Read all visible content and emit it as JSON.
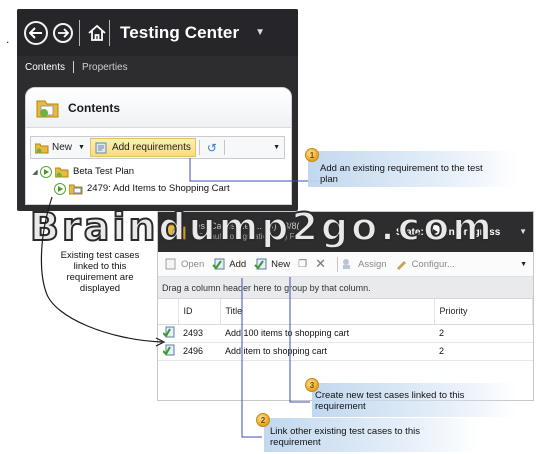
{
  "top_window": {
    "title": "Testing Center",
    "tabs": [
      "Contents",
      "Properties"
    ],
    "panel_title": "Contents",
    "toolbar": {
      "new_label": "New",
      "add_requirements_label": "Add requirements"
    },
    "tree": {
      "plan": "Beta Test Plan",
      "requirement": "2479: Add Items to Shopping Cart"
    }
  },
  "bottom_window": {
    "header_text": "Test Cases Req... (B) 23/8(...)",
    "header_sub": "Default configurations (1)  Reg...",
    "state_label": "State:",
    "state_value": "In progress",
    "toolbar": {
      "open": "Open",
      "add": "Add",
      "new": "New",
      "assign": "Assign",
      "configure": "Configur..."
    },
    "group_hint": "Drag a column header here to group by that column.",
    "columns": [
      "ID",
      "Title",
      "Priority"
    ],
    "rows": [
      {
        "id": "2493",
        "title": "Add 100 items to shopping cart",
        "priority": "2"
      },
      {
        "id": "2496",
        "title": "Add item to shopping cart",
        "priority": "2"
      }
    ]
  },
  "callouts": {
    "c1": {
      "num": "1",
      "text": "Add an existing requirement to the test plan"
    },
    "c2": {
      "num": "2",
      "text": "Link other existing test cases to this requirement"
    },
    "c3": {
      "num": "3",
      "text": "Create new test cases linked to this requirement"
    },
    "side": "Existing test cases linked to this requirement are displayed"
  },
  "watermark": "Braindump2go.com",
  "colors": {
    "dark_chrome": "#2d2d30",
    "highlight": "#f8dc7c",
    "badge": "#e7a21b",
    "callout_line": "#3c4fb0"
  }
}
